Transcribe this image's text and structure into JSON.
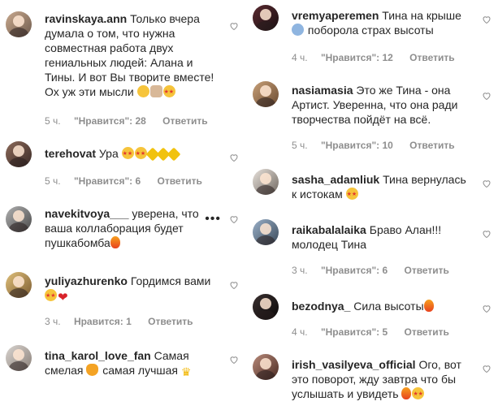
{
  "heart_icon": "heart-outline-icon",
  "more_icon": "more-dots-icon",
  "left_comments": [
    {
      "username": "ravinskaya.ann",
      "lines": [
        "Только вчера",
        "думала о том, что нужна",
        "совместная работа двух",
        "гениальных людей: Алана и",
        "Тины. И вот Вы творите вместе!",
        "Ох уж эти мысли"
      ],
      "time": "5 ч.",
      "likes": "\"Нравится\": 28",
      "reply": "Ответить"
    },
    {
      "username": "terehovat",
      "lines": [
        "Ура"
      ],
      "time": "5 ч.",
      "likes": "\"Нравится\": 6",
      "reply": "Ответить"
    },
    {
      "username": "navekitvoya___",
      "lines": [
        "уверена, что",
        "ваша коллаборация будет",
        "пушкабомба"
      ],
      "time": "",
      "likes": "",
      "reply": "",
      "more": "•••"
    },
    {
      "username": "yuliyazhurenko",
      "lines": [
        "Гордимся вами"
      ],
      "time": "3 ч.",
      "likes": "Нравится: 1",
      "reply": "Ответить"
    },
    {
      "username": "tina_karol_love_fan",
      "lines": [
        "Самая",
        "смелая",
        "самая лучшая"
      ],
      "time": "",
      "likes": "",
      "reply": ""
    }
  ],
  "right_comments": [
    {
      "username": "vremyaperemen",
      "lines": [
        "Тина на крыше",
        "поборола страх высоты"
      ],
      "time": "4 ч.",
      "likes": "\"Нравится\": 12",
      "reply": "Ответить"
    },
    {
      "username": "nasiamasia",
      "lines": [
        "Это же Тина - она",
        "Артист. Уверенна, что она ради",
        "творчества пойдёт на всё."
      ],
      "time": "5 ч.",
      "likes": "\"Нравится\": 10",
      "reply": "Ответить"
    },
    {
      "username": "sasha_adamliuk",
      "lines": [
        "Тина вернулась",
        "к истокам"
      ],
      "time": "",
      "likes": "",
      "reply": ""
    },
    {
      "username": "raikabalalaika",
      "lines": [
        "Браво Алан!!!",
        "молодец Тина"
      ],
      "time": "3 ч.",
      "likes": "\"Нравится\": 6",
      "reply": "Ответить"
    },
    {
      "username": "bezodnya_",
      "lines": [
        "Сила высоты"
      ],
      "time": "4 ч.",
      "likes": "\"Нравится\": 5",
      "reply": "Ответить"
    },
    {
      "username": "irish_vasilyeva_official",
      "lines": [
        "Ого, вот",
        "это поворот, жду завтра что бы",
        "услышать и увидеть"
      ],
      "time": "",
      "likes": "",
      "reply": ""
    }
  ],
  "colors": {
    "text": "#262626",
    "meta": "#8e8e8e",
    "heart_red": "#d8232a"
  }
}
